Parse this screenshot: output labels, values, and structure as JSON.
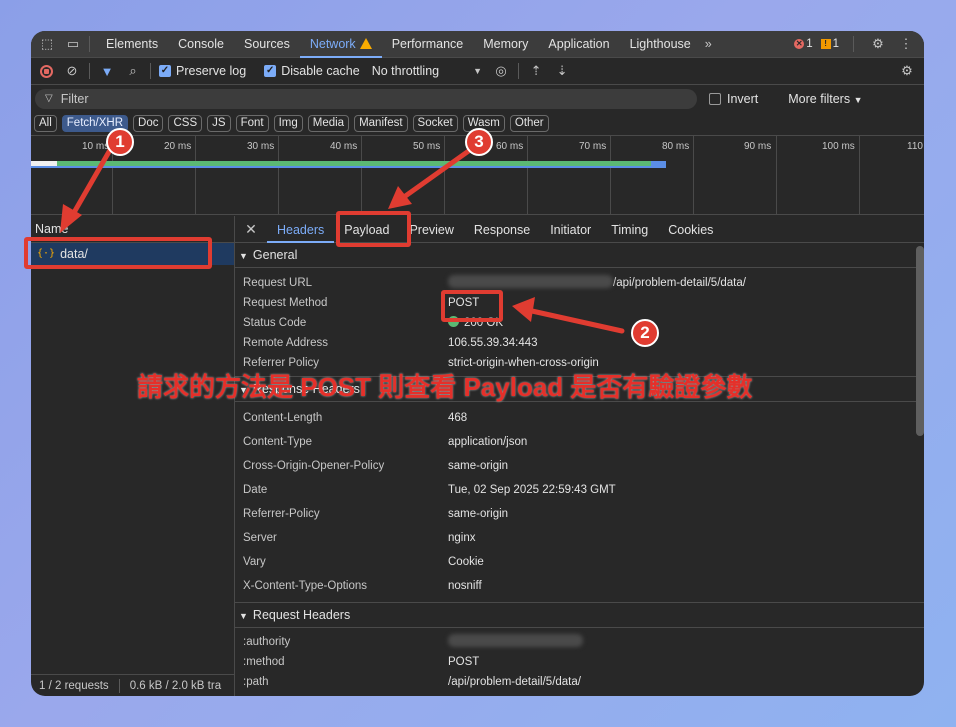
{
  "tabbar": {
    "tabs": [
      "Elements",
      "Console",
      "Sources",
      "Network",
      "Performance",
      "Memory",
      "Application",
      "Lighthouse"
    ],
    "active": "Network",
    "more": "»",
    "errors": "1",
    "warnings": "1"
  },
  "toolbar": {
    "preserve_log": "Preserve log",
    "disable_cache": "Disable cache",
    "throttling": "No throttling"
  },
  "filter": {
    "placeholder": "Filter",
    "invert": "Invert",
    "more_filters": "More filters"
  },
  "types": [
    "All",
    "Fetch/XHR",
    "Doc",
    "CSS",
    "JS",
    "Font",
    "Img",
    "Media",
    "Manifest",
    "Socket",
    "Wasm",
    "Other"
  ],
  "active_type": "Fetch/XHR",
  "timeline": {
    "ticks": [
      "10 ms",
      "20 ms",
      "30 ms",
      "40 ms",
      "50 ms",
      "60 ms",
      "70 ms",
      "80 ms",
      "90 ms",
      "100 ms",
      "110"
    ]
  },
  "requests": {
    "header": "Name",
    "items": [
      {
        "name": "data/"
      }
    ],
    "summary": "1 / 2 requests",
    "transfer": "0.6 kB / 2.0 kB tra"
  },
  "detail": {
    "tabs": [
      "Headers",
      "Payload",
      "Preview",
      "Response",
      "Initiator",
      "Timing",
      "Cookies"
    ],
    "active": "Headers",
    "general": {
      "title": "General",
      "request_url_label": "Request URL",
      "request_url_value": "/api/problem-detail/5/data/",
      "request_method_label": "Request Method",
      "request_method_value": "POST",
      "status_code_label": "Status Code",
      "status_code_value": "200 OK",
      "remote_address_label": "Remote Address",
      "remote_address_value": "106.55.39.34:443",
      "referrer_policy_label": "Referrer Policy",
      "referrer_policy_value": "strict-origin-when-cross-origin"
    },
    "response_headers": {
      "title": "Response Headers",
      "rows": [
        {
          "k": "Content-Length",
          "v": "468"
        },
        {
          "k": "Content-Type",
          "v": "application/json"
        },
        {
          "k": "Cross-Origin-Opener-Policy",
          "v": "same-origin"
        },
        {
          "k": "Date",
          "v": "Tue, 02 Sep 2025 22:59:43 GMT"
        },
        {
          "k": "Referrer-Policy",
          "v": "same-origin"
        },
        {
          "k": "Server",
          "v": "nginx"
        },
        {
          "k": "Vary",
          "v": "Cookie"
        },
        {
          "k": "X-Content-Type-Options",
          "v": "nosniff"
        }
      ]
    },
    "request_headers": {
      "title": "Request Headers",
      "authority_label": ":authority",
      "method_label": ":method",
      "method_value": "POST",
      "path_label": ":path",
      "path_value": "/api/problem-detail/5/data/"
    }
  },
  "annotations": {
    "n1": "1",
    "n2": "2",
    "n3": "3",
    "caption": "請求的方法是 POST 則查看 Payload 是否有驗證參數",
    "color": "#e03c31"
  }
}
